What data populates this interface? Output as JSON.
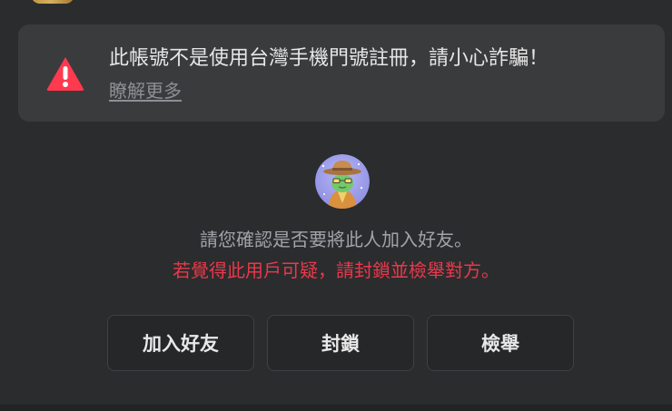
{
  "warning": {
    "message": "此帳號不是使用台灣手機門號註冊，請小心詐騙！",
    "link": "瞭解更多",
    "icon": "warning-triangle-icon",
    "accent": "#ff3a4f"
  },
  "confirm": {
    "question": "請您確認是否要將此人加入好友。",
    "warning": "若覺得此用戶可疑，請封鎖並檢舉對方。",
    "warning_color": "#e9394a"
  },
  "actions": {
    "add_friend": "加入好友",
    "block": "封鎖",
    "report": "檢舉"
  },
  "profile": {
    "avatar_icon": "frog-cowboy-avatar-icon"
  }
}
